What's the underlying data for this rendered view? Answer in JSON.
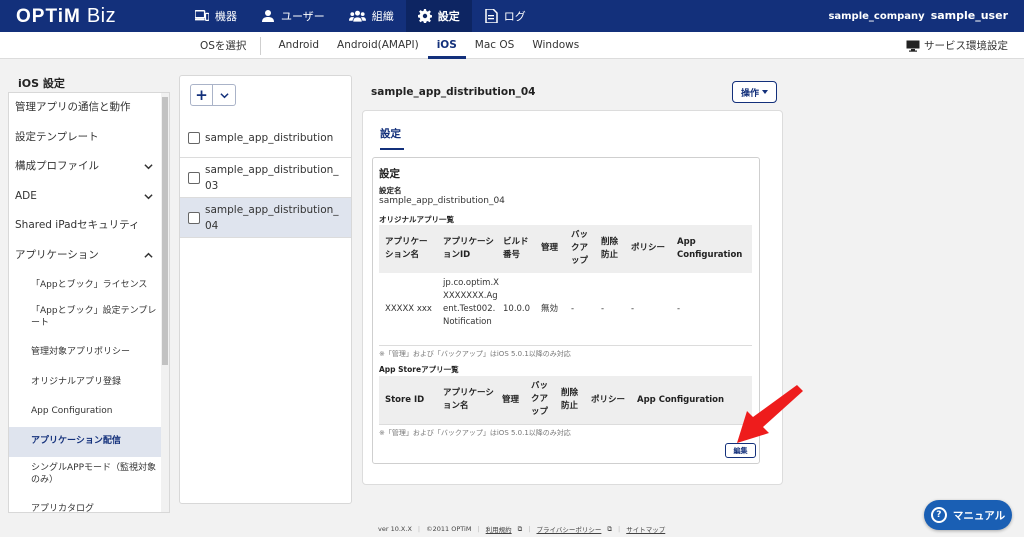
{
  "header": {
    "logo_main": "OPTiM",
    "logo_sub": "Biz",
    "nav": [
      {
        "label": "機器",
        "icon": "device-icon"
      },
      {
        "label": "ユーザー",
        "icon": "user-icon"
      },
      {
        "label": "組織",
        "icon": "group-icon"
      },
      {
        "label": "設定",
        "icon": "gear-icon",
        "active": true
      },
      {
        "label": "ログ",
        "icon": "log-icon"
      }
    ],
    "company": "sample_company",
    "user": "sample_user",
    "accent": "#13307b"
  },
  "subnav": {
    "os_label": "OSを選択",
    "tabs": [
      "Android",
      "Android(AMAPI)",
      "iOS",
      "Mac OS",
      "Windows"
    ],
    "active": "iOS",
    "service_settings": "サービス環境設定"
  },
  "sidebar": {
    "title": "iOS 設定",
    "items": [
      {
        "label": "管理アプリの通信と動作"
      },
      {
        "label": "設定テンプレート"
      },
      {
        "label": "構成プロファイル",
        "chevron": "down"
      },
      {
        "label": "ADE",
        "chevron": "down"
      },
      {
        "label": "Shared iPadセキュリティ"
      },
      {
        "label": "アプリケーション",
        "chevron": "up"
      },
      {
        "label": "「Appとブック」ライセンス",
        "sub": true
      },
      {
        "label": "「Appとブック」設定テンプレート",
        "sub": true
      },
      {
        "label": "管理対象アプリポリシー",
        "sub": true
      },
      {
        "label": "オリジナルアプリ登録",
        "sub": true
      },
      {
        "label": "App Configuration",
        "sub": true
      },
      {
        "label": "アプリケーション配信",
        "sub": true,
        "active": true
      },
      {
        "label": "シングルAPPモード（監視対象のみ）",
        "sub": true
      },
      {
        "label": "アプリカタログ",
        "sub": true
      }
    ]
  },
  "list": {
    "add_label": "+",
    "items": [
      "sample_app_distribution",
      "sample_app_distribution_03",
      "sample_app_distribution_04"
    ],
    "selected_index": 2
  },
  "detail": {
    "title": "sample_app_distribution_04",
    "operations_label": "操作",
    "tab": "設定",
    "section_title": "設定",
    "setting_name_label": "設定名",
    "setting_name_value": "sample_app_distribution_04",
    "original_apps_label": "オリジナルアプリ一覧",
    "original_table": {
      "headers": [
        "アプリケーション名",
        "アプリケーションID",
        "ビルド番号",
        "管理",
        "バックアップ",
        "削除防止",
        "ポリシー",
        "App Configuration"
      ],
      "rows": [
        [
          "XXXXX xxx",
          "jp.co.optim.XXXXXXXX.Agent.Test002.Notification",
          "10.0.0",
          "無効",
          "-",
          "-",
          "-",
          "-"
        ]
      ]
    },
    "note": "※「管理」および「バックアップ」はiOS 5.0.1以降のみ対応",
    "appstore_label": "App Storeアプリ一覧",
    "appstore_table": {
      "headers": [
        "Store ID",
        "アプリケーション名",
        "管理",
        "バックアップ",
        "削除防止",
        "ポリシー",
        "App Configuration"
      ],
      "rows": []
    },
    "edit_label": "編集"
  },
  "footer": {
    "version": "ver 10.X.X",
    "copyright": "©2011 OPTiM",
    "links": [
      "利用規約",
      "プライバシーポリシー",
      "サイトマップ"
    ]
  },
  "manual_button": "マニュアル",
  "annotation_arrow_color": "#ee1c1c"
}
